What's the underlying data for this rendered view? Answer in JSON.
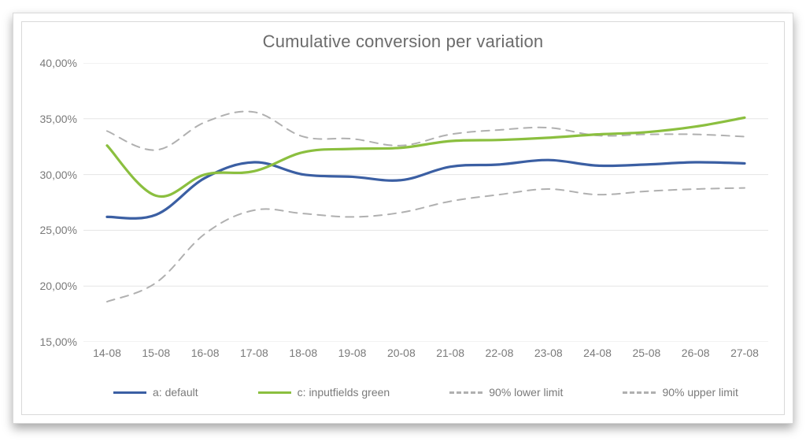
{
  "chart_data": {
    "type": "line",
    "title": "Cumulative conversion per variation",
    "xlabel": "",
    "ylabel": "",
    "ylim": [
      15,
      40
    ],
    "y_ticks": [
      "15,00%",
      "20,00%",
      "25,00%",
      "30,00%",
      "35,00%",
      "40,00%"
    ],
    "categories": [
      "14-08",
      "15-08",
      "16-08",
      "17-08",
      "18-08",
      "19-08",
      "20-08",
      "21-08",
      "22-08",
      "23-08",
      "24-08",
      "25-08",
      "26-08",
      "27-08"
    ],
    "series": [
      {
        "name": "a: default",
        "color": "#3b5fa3",
        "dashed": false,
        "values": [
          26.2,
          26.4,
          29.7,
          31.1,
          30.0,
          29.8,
          29.5,
          30.7,
          30.9,
          31.3,
          30.8,
          30.9,
          31.1,
          31.0
        ]
      },
      {
        "name": "c: inputfields green",
        "color": "#8bbf3f",
        "dashed": false,
        "values": [
          32.6,
          28.1,
          30.0,
          30.3,
          32.0,
          32.3,
          32.4,
          33.0,
          33.1,
          33.3,
          33.6,
          33.8,
          34.3,
          35.1
        ]
      },
      {
        "name": "90% lower limit",
        "color": "#b0b0b0",
        "dashed": true,
        "values": [
          18.6,
          20.3,
          24.7,
          26.8,
          26.5,
          26.2,
          26.6,
          27.6,
          28.2,
          28.7,
          28.2,
          28.5,
          28.7,
          28.8
        ]
      },
      {
        "name": "90% upper limit",
        "color": "#b0b0b0",
        "dashed": true,
        "values": [
          33.9,
          32.2,
          34.7,
          35.6,
          33.4,
          33.2,
          32.6,
          33.6,
          34.0,
          34.2,
          33.5,
          33.6,
          33.6,
          33.4
        ]
      }
    ]
  }
}
